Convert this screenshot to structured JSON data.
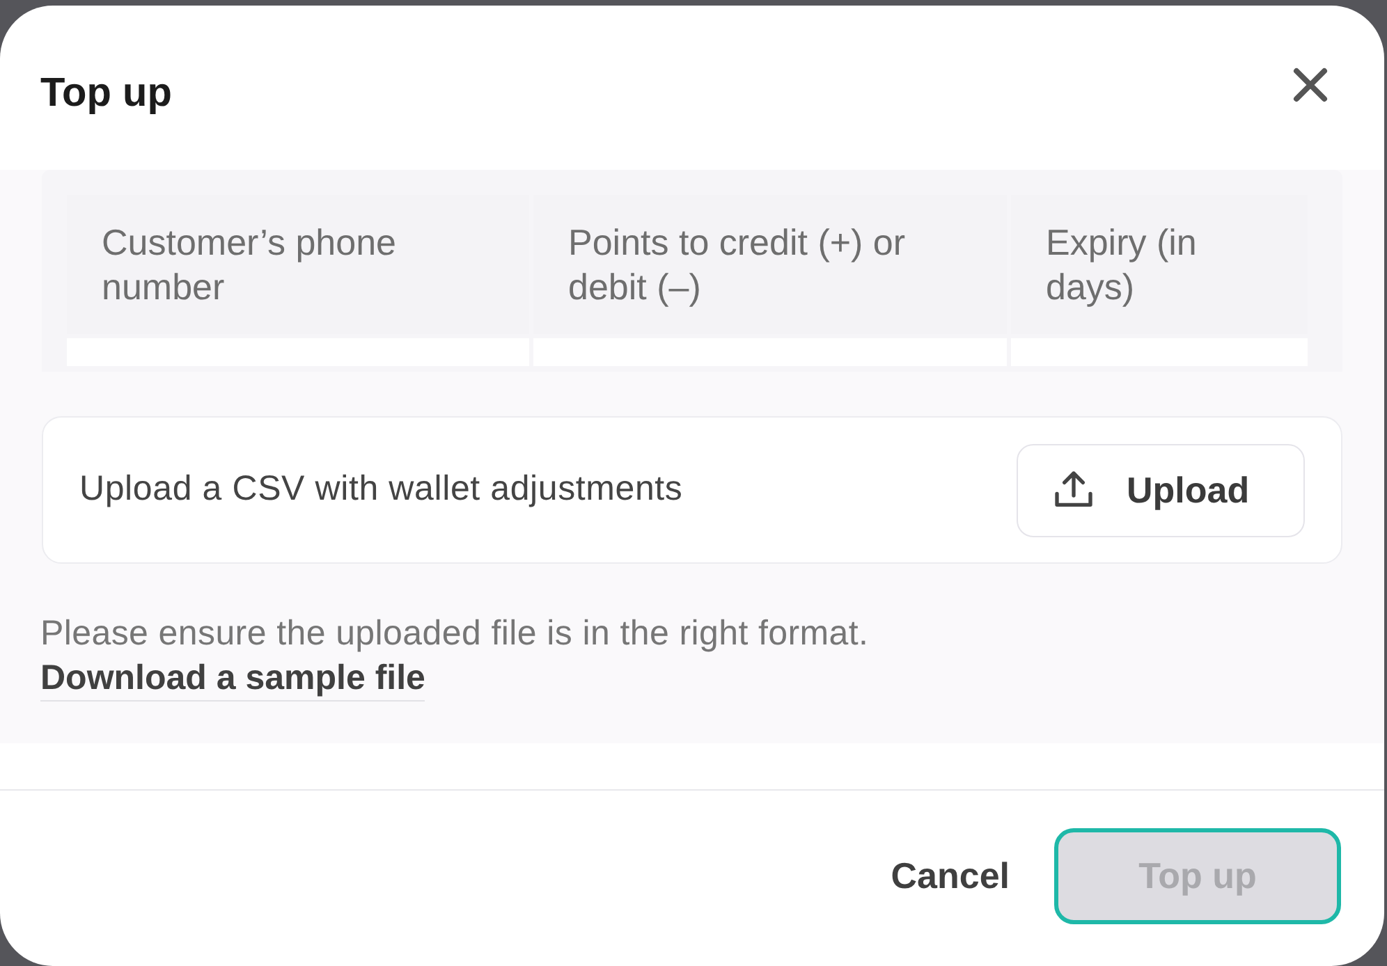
{
  "dialog": {
    "title": "Top up"
  },
  "table": {
    "columns": [
      "Customer’s phone number",
      "Points to credit (+) or debit (–)",
      "Expiry (in days)"
    ]
  },
  "upload": {
    "label": "Upload a CSV with wallet adjustments",
    "button": "Upload"
  },
  "help": {
    "text": "Please ensure the uploaded file is in the right format.",
    "link": "Download a sample file"
  },
  "footer": {
    "buttons": [
      {
        "label": "Cancel",
        "kind": "secondary",
        "disabled": false
      },
      {
        "label": "Top up",
        "kind": "primary",
        "disabled": true
      }
    ]
  }
}
